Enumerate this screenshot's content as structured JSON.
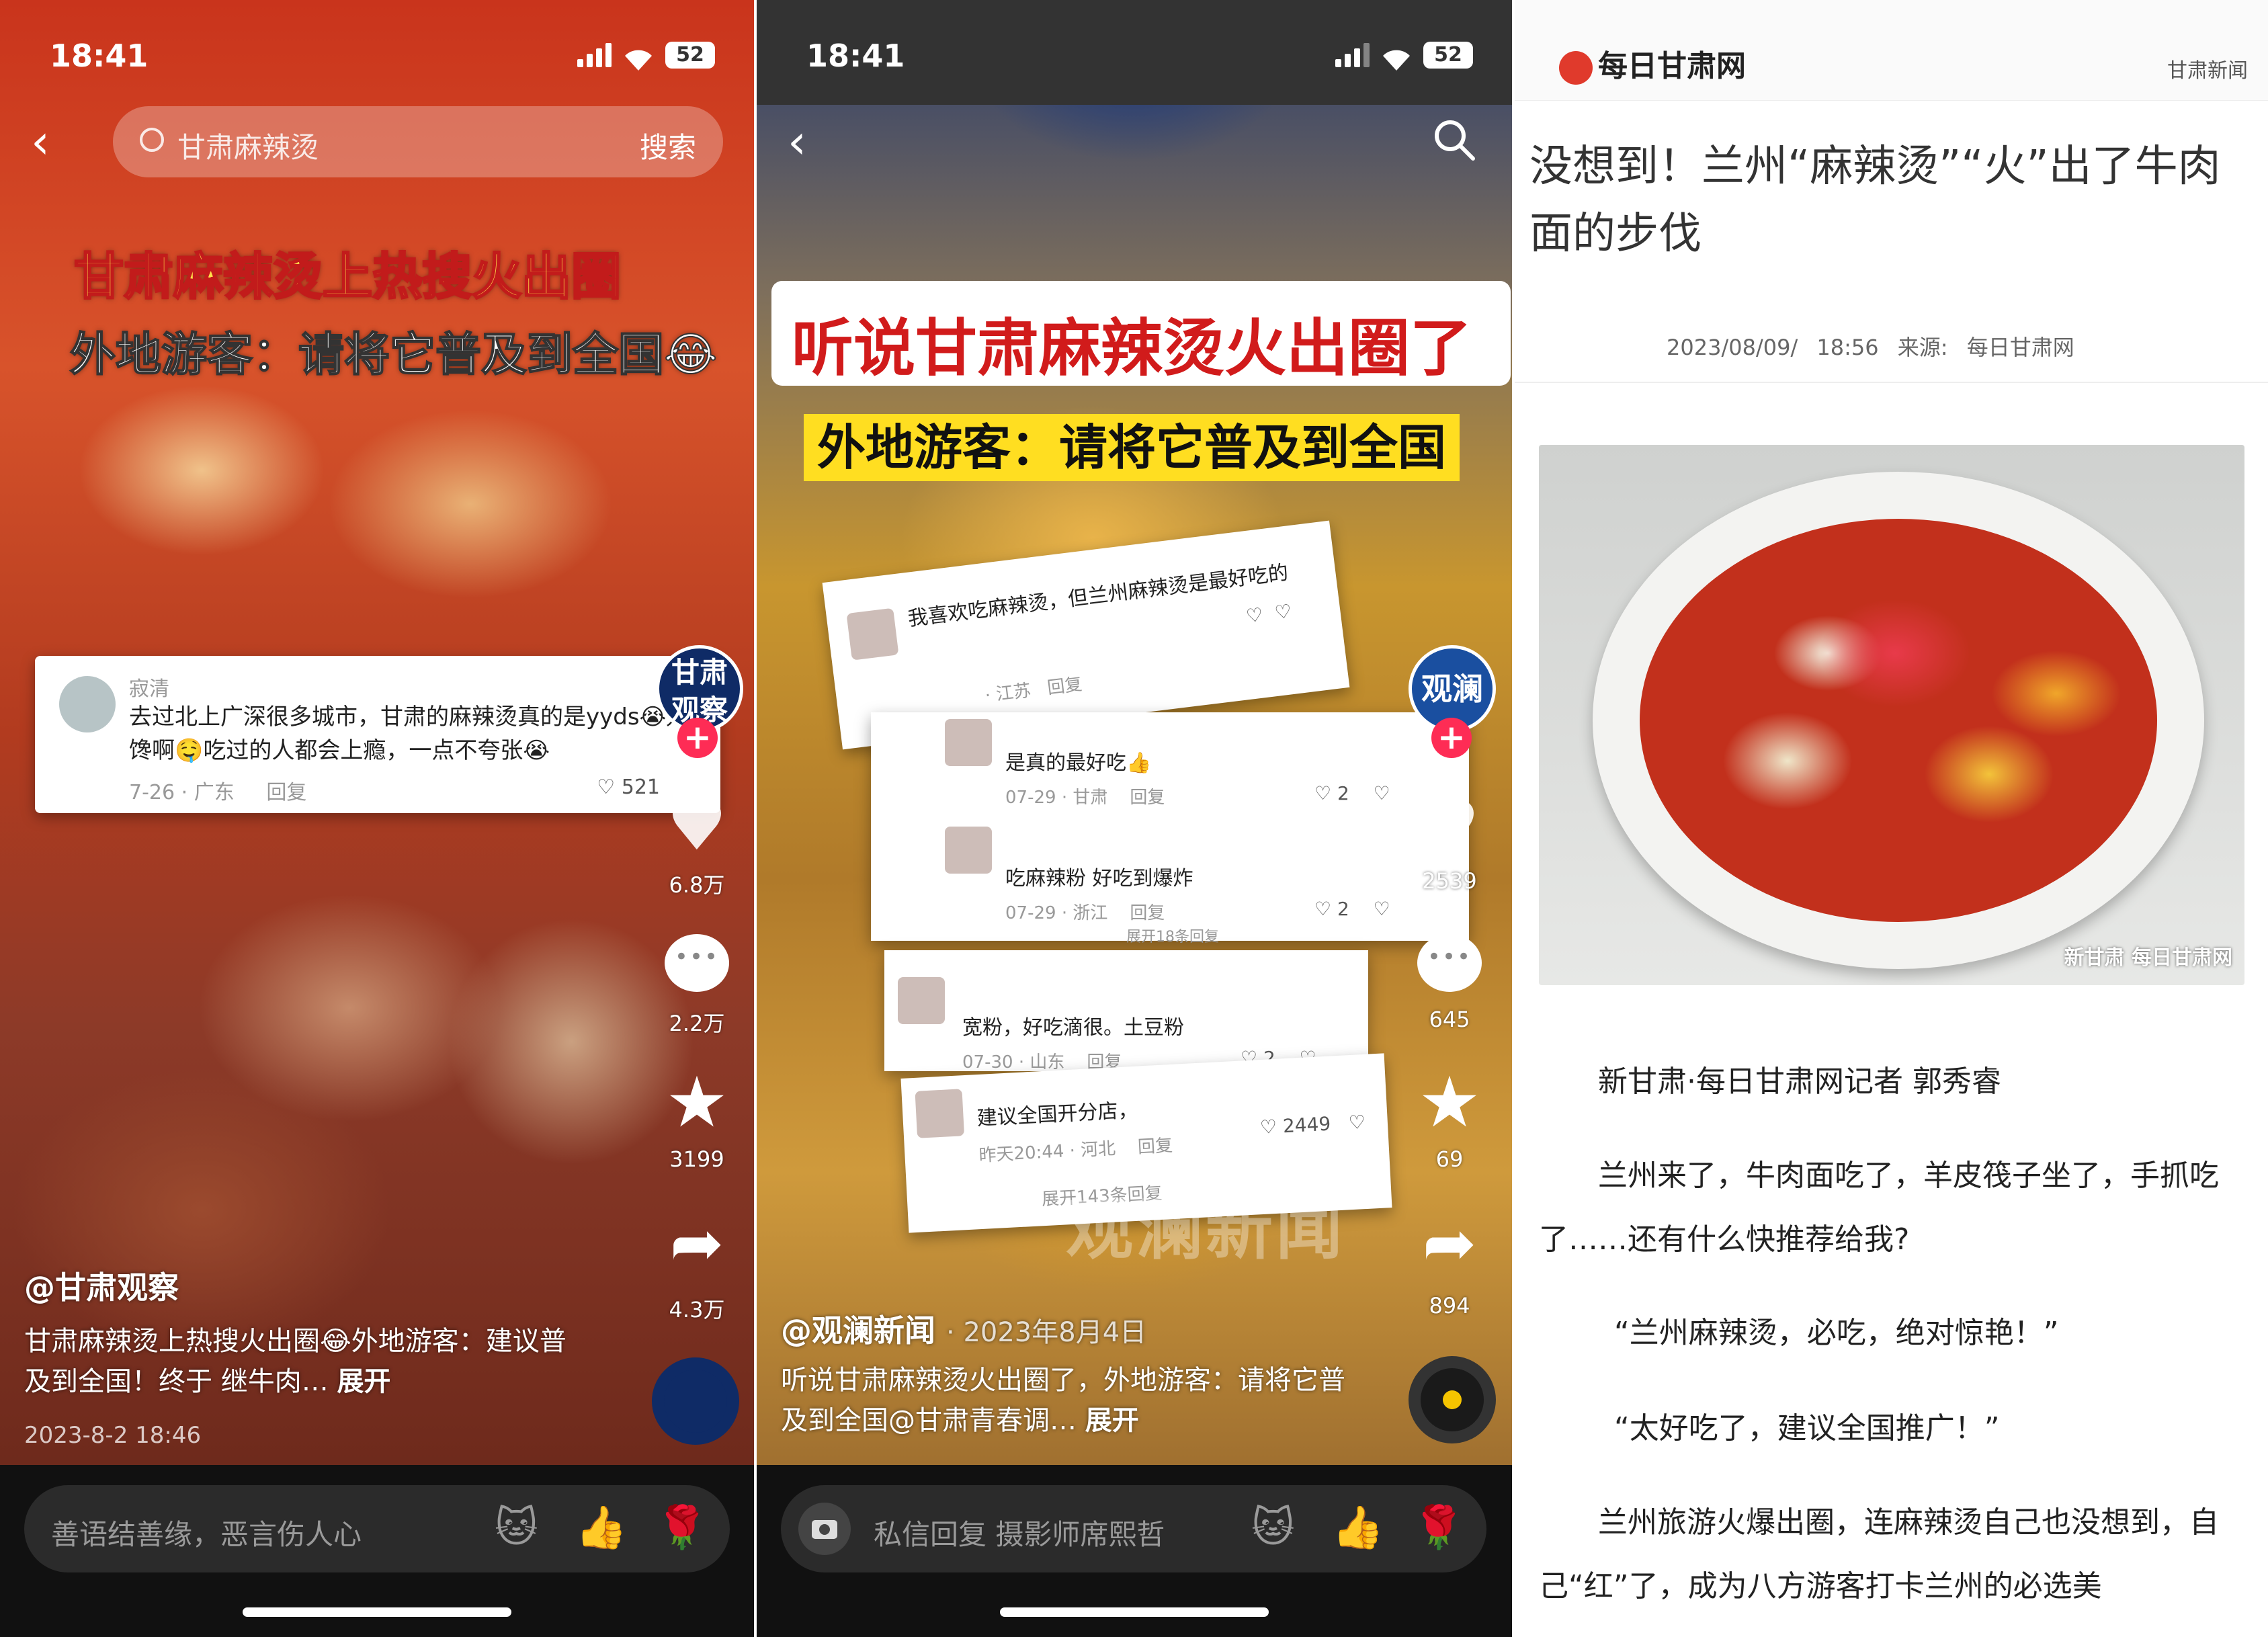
{
  "panel1": {
    "status": {
      "time": "18:41",
      "battery": "52"
    },
    "search": {
      "placeholder": "甘肃麻辣烫",
      "button": "搜索"
    },
    "headline": {
      "line1": "甘肃麻辣烫上热搜火出圈",
      "line2": "外地游客：请将它普及到全国😂"
    },
    "comment": {
      "name": "寂清",
      "text": "去过北上广深很多城市，甘肃的麻辣烫真的是yyds😭好馋啊🤤吃过的人都会上瘾，一点不夸张😭",
      "meta": "7-26 · 广东",
      "reply": "回复",
      "likes": "521"
    },
    "avatar_text": "甘肃观察",
    "sidebar": {
      "likes": "6.8万",
      "comments": "2.2万",
      "favorites": "3199",
      "shares": "4.3万"
    },
    "author": "@甘肃观察",
    "description": "甘肃麻辣烫上热搜火出圈😂外地游客：建议普及到全国！终于 继牛肉…",
    "expand": "展开",
    "date": "2023-8-2 18:46",
    "input_placeholder": "善语结善缘，恶言伤人心",
    "emojis": [
      "🐱",
      "👍",
      "🌹"
    ]
  },
  "panel2": {
    "status": {
      "time": "18:41",
      "battery": "52"
    },
    "headline": {
      "line1": "听说甘肃麻辣烫火出圈了",
      "line2": "外地游客：请将它普及到全国"
    },
    "comments": [
      {
        "text": "我喜欢吃麻辣烫，但兰州麻辣烫是最好吃的",
        "meta": "· 江苏",
        "reply": "回复",
        "likes": ""
      },
      {
        "text": "是真的最好吃👍",
        "meta": "07-29 · 甘肃",
        "reply": "回复",
        "likes": "2"
      },
      {
        "text": "吃麻辣粉 好吃到爆炸",
        "meta": "07-29 · 浙江",
        "reply": "回复",
        "likes": "2"
      },
      {
        "text": "展开18条回复",
        "meta": "",
        "reply": "",
        "likes": ""
      },
      {
        "text": "宽粉，好吃滴很。土豆粉",
        "meta": "07-30 · 山东",
        "reply": "回复",
        "likes": "2"
      },
      {
        "text": "建议全国开分店，",
        "meta": "昨天20:44 · 河北",
        "reply": "回复",
        "likes": "2449"
      },
      {
        "text": "展开143条回复",
        "meta": "",
        "reply": "",
        "likes": ""
      }
    ],
    "avatar_text": "观澜",
    "sidebar": {
      "likes": "2539",
      "comments": "645",
      "favorites": "69",
      "shares": "894"
    },
    "watermark": "观澜新闻",
    "author": "@观澜新闻",
    "author_date": "· 2023年8月4日",
    "description": "听说甘肃麻辣烫火出圈了，外地游客：请将它普及到全国@甘肃青春调…",
    "expand": "展开",
    "input_placeholder": "私信回复 摄影师席熙哲",
    "emojis": [
      "🐱",
      "👍",
      "🌹"
    ]
  },
  "panel3": {
    "site_name": "每日甘肃网",
    "top_link": "甘肃新闻",
    "title": "没想到！兰州“麻辣烫”“火”出了牛肉面的步伐",
    "date": "2023/08/09/ 18:56",
    "source_label": "来源:",
    "source": "每日甘肃网",
    "photo_watermark": "新甘肃 每日甘肃网",
    "paragraphs": [
      "新甘肃·每日甘肃网记者 郭秀睿",
      "兰州来了，牛肉面吃了，羊皮筏子坐了，手抓吃了……还有什么快推荐给我?",
      "“兰州麻辣烫，必吃，绝对惊艳！”",
      "“太好吃了，建议全国推广！”",
      "兰州旅游火爆出圈，连麻辣烫自己也没想到，自己“红”了，成为八方游客打卡兰州的必选美"
    ]
  },
  "colors": {
    "like_red": "#fe2c55",
    "headline_yellow": "#ffe24a",
    "headline_red": "#d11b1b"
  }
}
